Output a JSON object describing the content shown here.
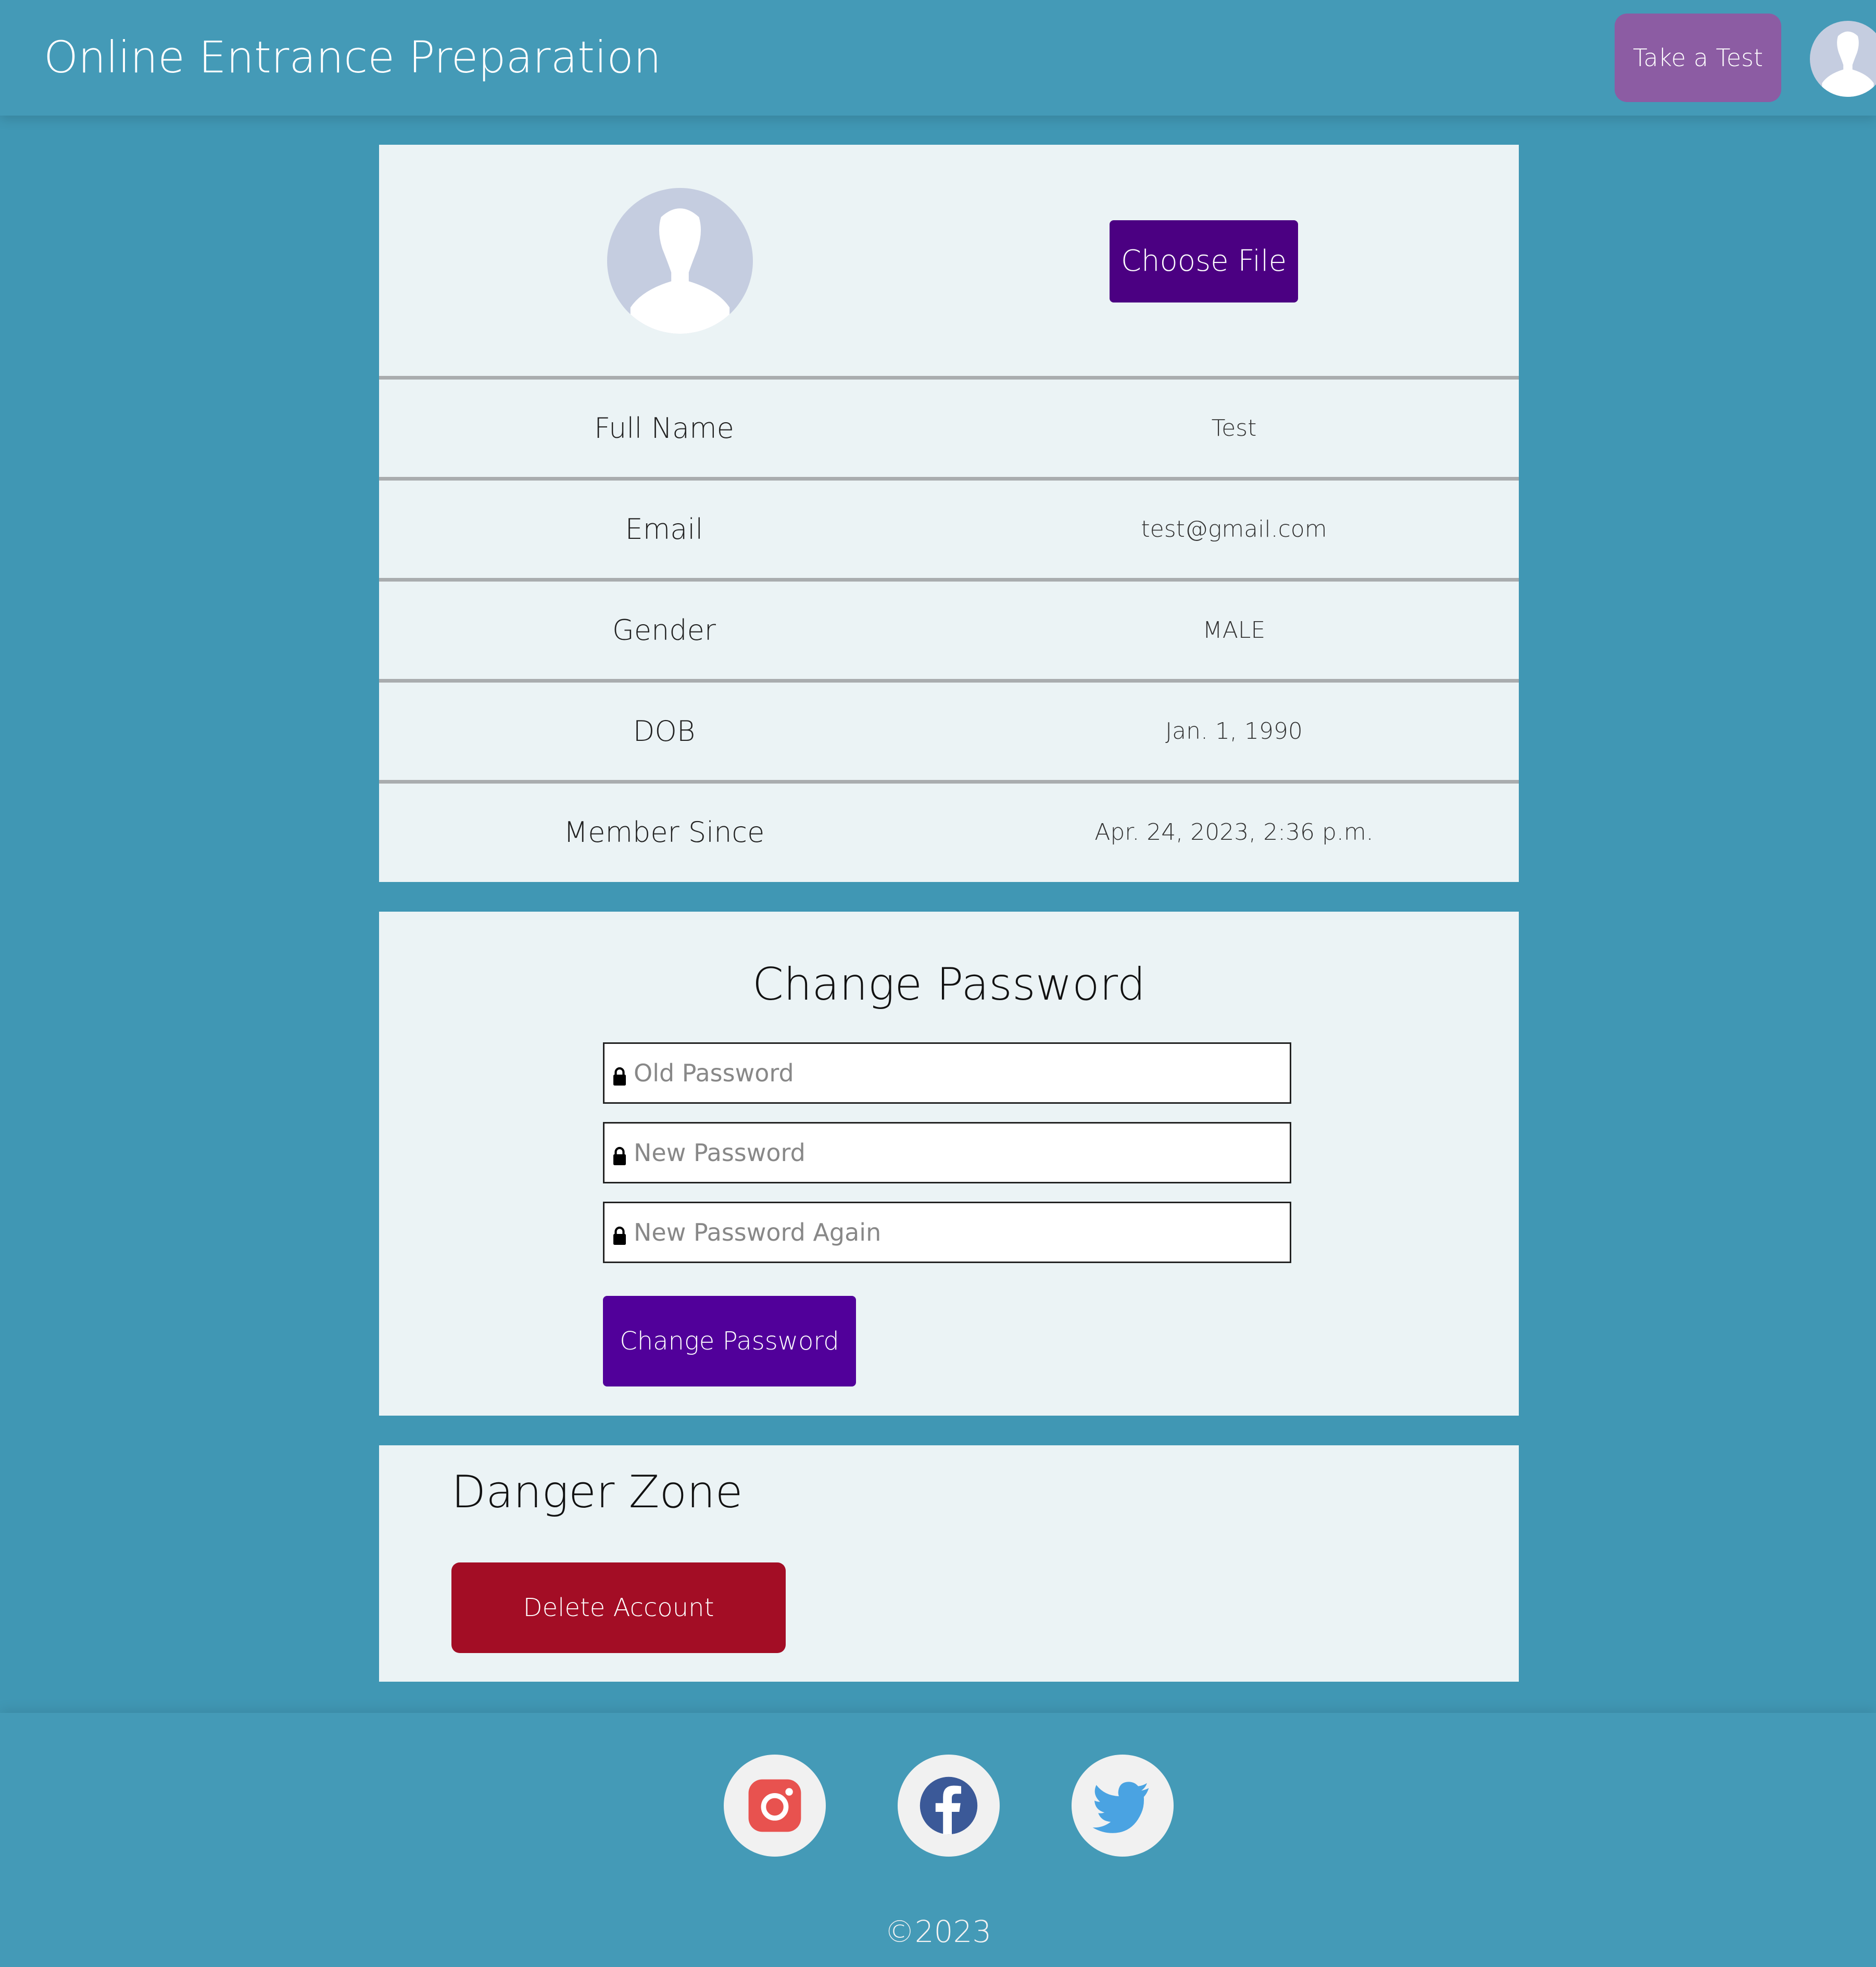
{
  "header": {
    "title": "Online Entrance Preparation",
    "take_test_label": "Take a Test"
  },
  "profile": {
    "choose_file_label": "Choose File",
    "rows": [
      {
        "label": "Full Name",
        "value": "Test"
      },
      {
        "label": "Email",
        "value": "test@gmail.com"
      },
      {
        "label": "Gender",
        "value": "MALE"
      },
      {
        "label": "DOB",
        "value": "Jan. 1, 1990"
      },
      {
        "label": "Member Since",
        "value": "Apr. 24, 2023, 2:36 p.m."
      }
    ]
  },
  "change_password": {
    "title": "Change Password",
    "old_placeholder": "Old Password",
    "new_placeholder": "New Password",
    "new_again_placeholder": "New Password Again",
    "submit_label": "Change Password"
  },
  "danger_zone": {
    "title": "Danger Zone",
    "delete_label": "Delete Account"
  },
  "footer": {
    "social": [
      "instagram-icon",
      "facebook-icon",
      "twitter-icon"
    ],
    "copyright": "©2023"
  },
  "colors": {
    "background": "#4097b4",
    "card": "#ebf3f5",
    "take_test": "#8c5ca3",
    "primary": "#4b0082",
    "danger": "#a30d25"
  }
}
